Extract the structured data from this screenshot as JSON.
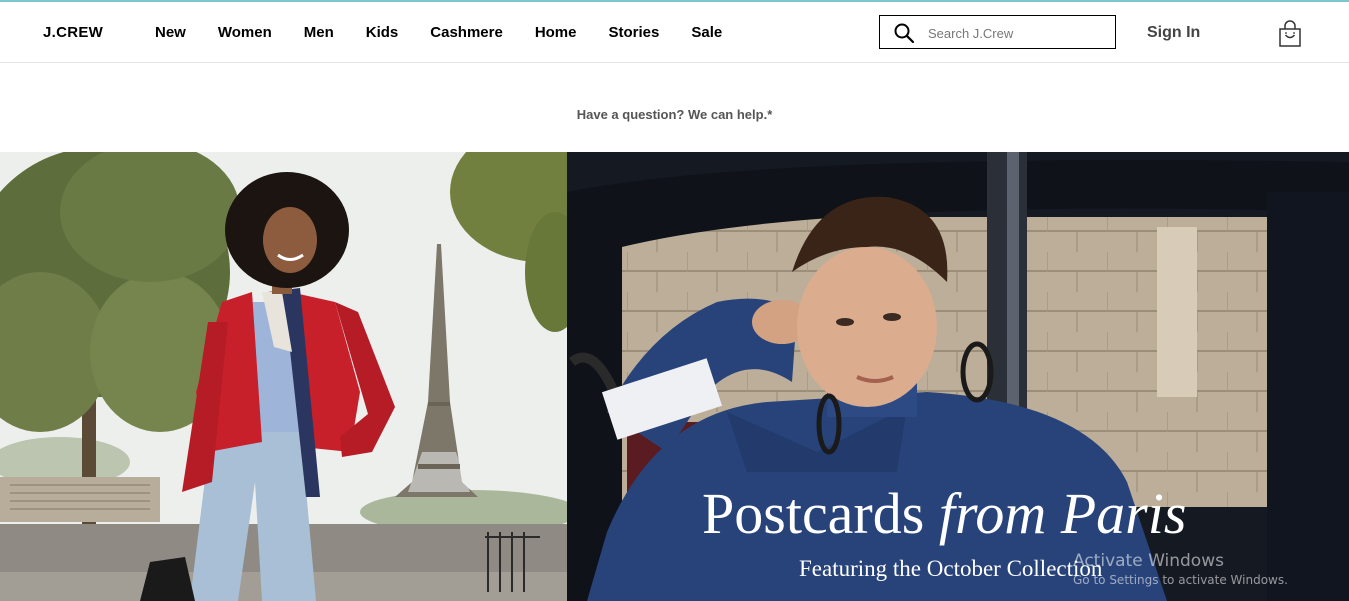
{
  "brand": {
    "logo": "J.CREW"
  },
  "nav": {
    "items": [
      {
        "label": "New",
        "key": "new"
      },
      {
        "label": "Women",
        "key": "women"
      },
      {
        "label": "Men",
        "key": "men"
      },
      {
        "label": "Kids",
        "key": "kids"
      },
      {
        "label": "Cashmere",
        "key": "cashmere"
      },
      {
        "label": "Home",
        "key": "home"
      },
      {
        "label": "Stories",
        "key": "stories"
      },
      {
        "label": "Sale",
        "key": "sale"
      }
    ]
  },
  "search": {
    "placeholder": "Search J.Crew",
    "value": "",
    "icon": "search-icon"
  },
  "account": {
    "signin_label": "Sign In",
    "bag_icon": "shopping-bag-icon"
  },
  "help_banner": {
    "text": "Have a question? We can help.*"
  },
  "hero": {
    "left_image": "woman-red-cardigan-eiffel-tower-photo",
    "right_image": "woman-blue-sweater-in-car-photo",
    "title_regular": "Postcards",
    "title_italic": "from Paris",
    "subtitle": "Featuring the October Collection"
  },
  "system_overlay": {
    "line1": "Activate Windows",
    "line2": "Go to Settings to activate Windows."
  },
  "colors": {
    "accent_topline": "#7fc4cf",
    "text": "#000000",
    "caption": "#ffffff",
    "cardigan_red": "#c8202a",
    "sweater_blue": "#27437a"
  }
}
